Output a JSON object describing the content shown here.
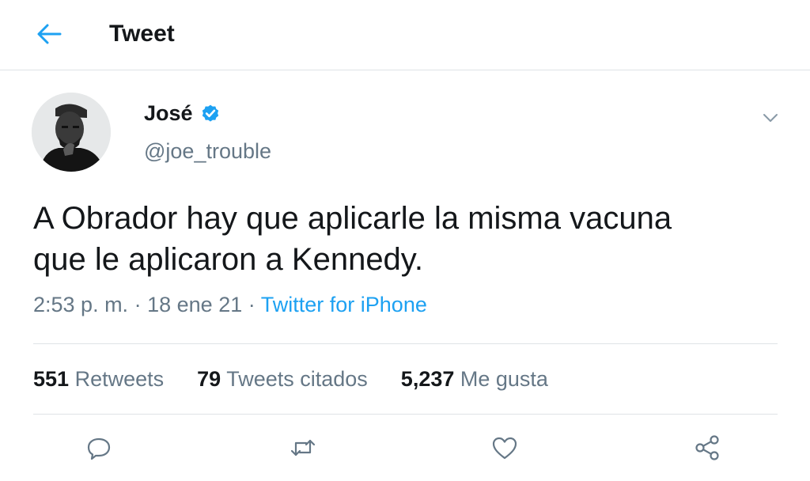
{
  "header": {
    "title": "Tweet",
    "back_icon": "arrow-left-icon",
    "accent": "#1da1f2"
  },
  "author": {
    "name": "José",
    "handle": "@joe_trouble",
    "verified": true,
    "verified_color": "#1da1f2"
  },
  "tweet": {
    "text_line1": "A Obrador hay que aplicarle la misma vacuna",
    "text_line2": "que le aplicaron a Kennedy.",
    "time": "2:53 p. m.",
    "dot1": "·",
    "date": "18 ene 21",
    "dot2": "·",
    "source": "Twitter for iPhone"
  },
  "stats": {
    "retweets": {
      "count": "551",
      "label": "Retweets"
    },
    "quotes": {
      "count": "79",
      "label": "Tweets citados"
    },
    "likes": {
      "count": "5,237",
      "label": "Me gusta"
    }
  },
  "actions": [
    "reply-icon",
    "retweet-icon",
    "like-icon",
    "share-icon"
  ],
  "colors": {
    "text": "#14171a",
    "secondary": "#657786",
    "divider": "#dfe3e6"
  }
}
